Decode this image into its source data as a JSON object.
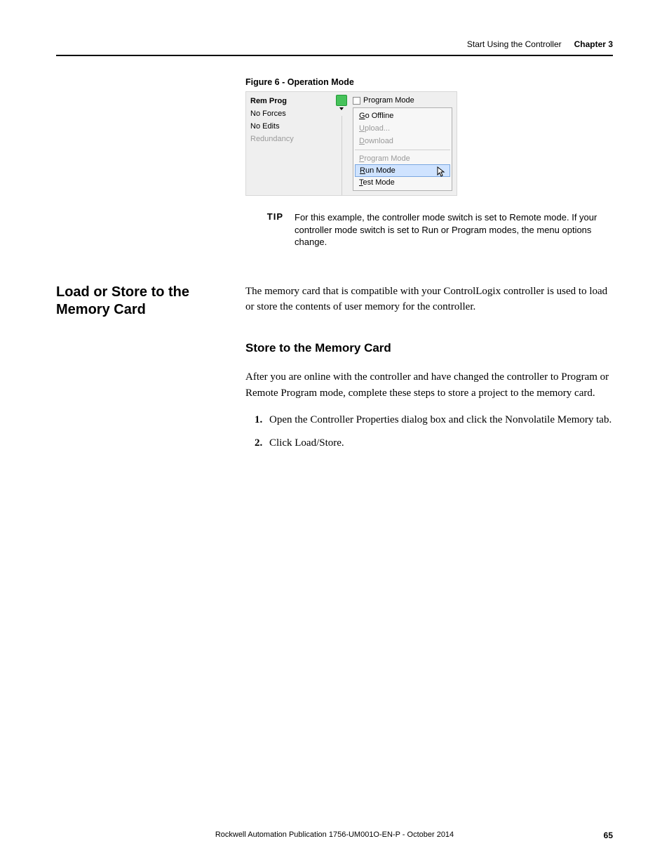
{
  "running_head": {
    "section": "Start Using the Controller",
    "chapter": "Chapter 3"
  },
  "figure": {
    "caption": "Figure 6 - Operation Mode",
    "left_rows": [
      {
        "text": "Rem Prog",
        "disabled": false,
        "bold": true
      },
      {
        "text": "No Forces",
        "disabled": false,
        "bold": false
      },
      {
        "text": "No Edits",
        "disabled": false,
        "bold": false
      },
      {
        "text": "Redundancy",
        "disabled": true,
        "bold": false
      }
    ],
    "mode_label": "Program Mode",
    "menu": {
      "go_offline": "Go Offline",
      "upload": "Upload...",
      "download": "Download",
      "program_mode": "Program Mode",
      "run_mode": "Run Mode",
      "test_mode": "Test Mode"
    }
  },
  "tip": {
    "label": "TIP",
    "text": "For this example, the controller mode switch is set to Remote mode. If your controller mode switch is set to Run or Program modes, the menu options change."
  },
  "side_heading": "Load or Store to the Memory Card",
  "body_intro": "The memory card that is compatible with your ControlLogix controller is used to load or store the contents of user memory for the controller.",
  "sub_heading": "Store to the Memory Card",
  "body_after_sub": "After you are online with the controller and have changed the controller to Program or Remote Program mode, complete these steps to store a project to the memory card.",
  "steps": [
    "Open the Controller Properties dialog box and click the Nonvolatile Memory tab.",
    "Click Load/Store."
  ],
  "footer": {
    "pub": "Rockwell Automation Publication 1756-UM001O-EN-P - October 2014",
    "page": "65"
  }
}
